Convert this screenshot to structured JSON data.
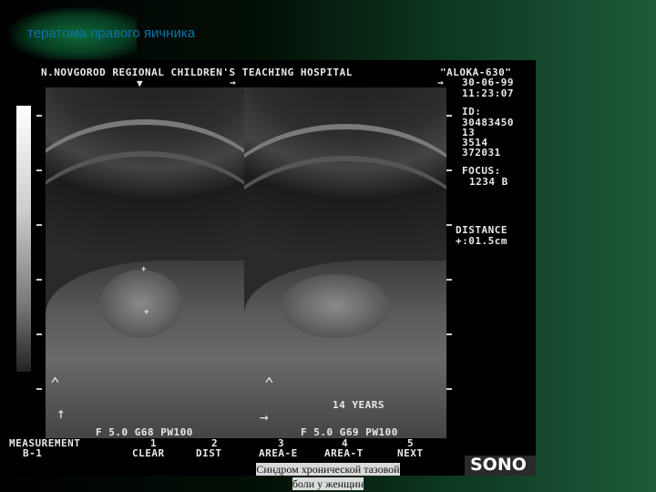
{
  "slide": {
    "title": "тератома правого яичника",
    "caption_line1": "Синдром хронической тазовой",
    "caption_line2": "боли у женщин"
  },
  "ultrasound": {
    "hospital": "N.NOVGOROD REGIONAL CHILDREN'S TEACHING HOSPITAL",
    "model": "\"ALOKA-630\"",
    "date": "30-06-99",
    "time": "11:23:07",
    "id_label": "ID:",
    "id_lines": [
      "30483450",
      "13",
      "3514",
      "372031"
    ],
    "focus_label": "FOCUS:",
    "focus_value": "1234 B",
    "distance_label": "DISTANCE",
    "distance_value": "+:01.5cm",
    "age_label": "14 YEARS",
    "left_params": "F 5.0 G68 PW100",
    "right_params": "F 5.0 G69 PW100",
    "menu": [
      {
        "top": "MEASUREMENT",
        "bottom": "B-1"
      },
      {
        "top": "1",
        "bottom": "CLEAR"
      },
      {
        "top": "2",
        "bottom": "DIST"
      },
      {
        "top": "3",
        "bottom": "AREA-E"
      },
      {
        "top": "4",
        "bottom": "AREA-T"
      },
      {
        "top": "5",
        "bottom": "NEXT"
      }
    ],
    "brand_logo": "SONO"
  }
}
